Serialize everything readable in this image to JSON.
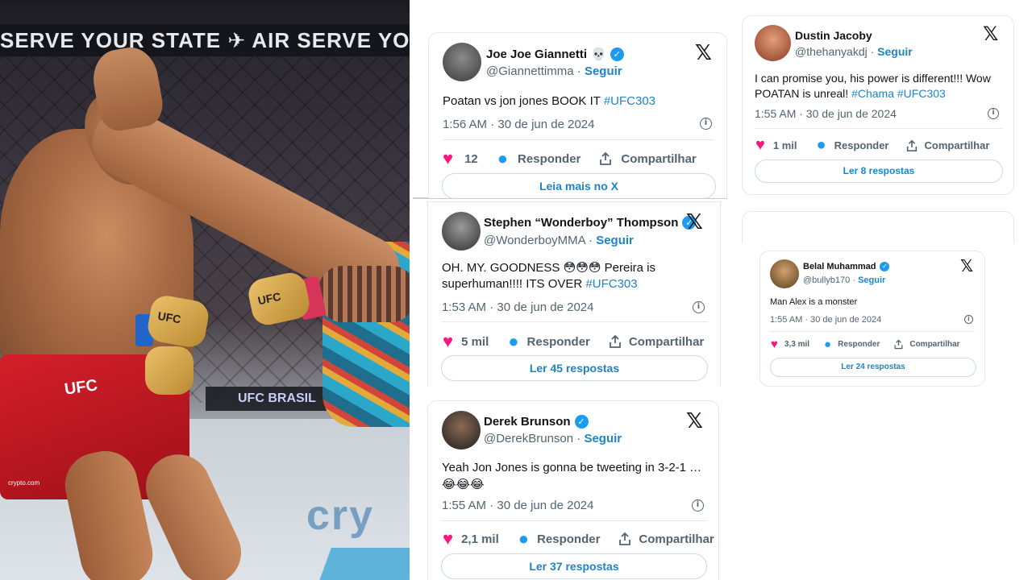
{
  "photo": {
    "banner_text": "SERVE YOUR STATE  ✈ AIR  SERVE YO",
    "shorts_brand": "UFC",
    "shorts_sub": "crypto.com",
    "glove_brand": "UFC",
    "mat_text": "cry",
    "lower_band_text": "UFC BRASIL"
  },
  "cards": [
    {
      "id": "giannetti",
      "name": "Joe Joe Giannetti",
      "name_emoji": "💀",
      "handle": "@Giannettimma",
      "separator": "·",
      "follow": "Seguir",
      "text_plain": "Poatan vs jon jones BOOK IT ",
      "text_tag": "#UFC303",
      "time": "1:56 AM · 30 de jun de 2024",
      "likes": "12",
      "reply": "Responder",
      "share": "Compartilhar",
      "more": "Leia mais no X",
      "avatar_color": "#4a4a4a"
    },
    {
      "id": "thompson",
      "name": "Stephen “Wonderboy” Thompson",
      "handle": "@WonderboyMMA",
      "separator": "·",
      "follow": "Seguir",
      "text_plain": "OH. MY. GOODNESS 😳😳😳   Pereira is superhuman!!!! ITS OVER ",
      "text_tag": "#UFC303",
      "time": "1:53 AM · 30 de jun de 2024",
      "likes": "5 mil",
      "reply": "Responder",
      "share": "Compartilhar",
      "more": "Ler 45 respostas",
      "avatar_color": "#3d3d3d"
    },
    {
      "id": "brunson",
      "name": "Derek Brunson",
      "handle": "@DerekBrunson",
      "separator": "·",
      "follow": "Seguir",
      "text_line1": "Yeah Jon Jones is gonna be tweeting in 3-2-1 …",
      "text_line2": "😂😂😂",
      "time": "1:55 AM · 30 de jun de 2024",
      "likes": "2,1 mil",
      "reply": "Responder",
      "share": "Compartilhar",
      "more": "Ler 37 respostas",
      "avatar_color": "#2e2e2e"
    },
    {
      "id": "jacoby",
      "name": "Dustin Jacoby",
      "handle": "@thehanyakdj",
      "separator": "·",
      "follow": "Seguir",
      "text_plain": "I can promise you, his power is different!!! Wow POATAN is unreal! ",
      "text_tag1": "#Chama",
      "text_tag2": "#UFC303",
      "time": "1:55 AM · 30 de jun de 2024",
      "likes": "1 mil",
      "reply": "Responder",
      "share": "Compartilhar",
      "more": "Ler 8 respostas",
      "avatar_color": "#b4533a"
    },
    {
      "id": "belal",
      "name": "Belal Muhammad",
      "handle": "@bullyb170",
      "separator": "·",
      "follow": "Seguir",
      "text_plain": "Man Alex is a monster",
      "time": "1:55 AM · 30 de jun de 2024",
      "likes": "3,3 mil",
      "reply": "Responder",
      "share": "Compartilhar",
      "more": "Ler 24 respostas",
      "avatar_color": "#7a5a2a"
    }
  ],
  "icons": {
    "x_logo": "𝕏",
    "heart": "♥",
    "bubble": "●",
    "info": "i",
    "check": "✓"
  },
  "colors": {
    "link": "#1d84c6",
    "heart": "#f91880",
    "verified": "#1d9bf0",
    "muted": "#536471"
  }
}
